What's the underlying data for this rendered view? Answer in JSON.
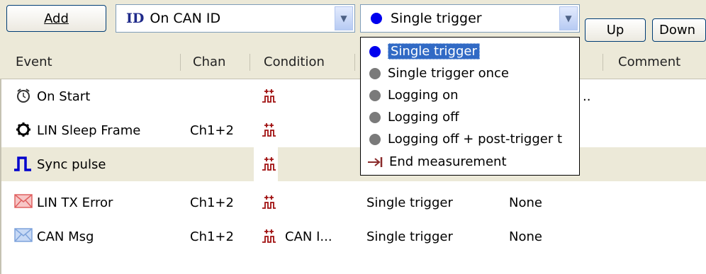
{
  "toolbar": {
    "add_label": "Add",
    "event_type": {
      "logo": "ID",
      "value": "On CAN ID"
    },
    "action_select": {
      "value": "Single trigger"
    },
    "up_label": "Up",
    "down_label": "Down"
  },
  "table": {
    "columns": [
      "Event",
      "Chan",
      "Condition",
      "Comment"
    ],
    "rows": [
      {
        "event": "On Start",
        "chan": "",
        "condition": "",
        "action": "",
        "comment": "",
        "trunc": "..",
        "icon": "alarm-clock-icon"
      },
      {
        "event": "LIN Sleep Frame",
        "chan": "Ch1+2",
        "condition": "",
        "action": "",
        "comment": "",
        "icon": "gear-icon"
      },
      {
        "event": "Sync pulse",
        "chan": "",
        "condition": "",
        "action": "",
        "comment": "",
        "icon": "pulse-icon"
      },
      {
        "event": "LIN TX Error",
        "chan": "Ch1+2",
        "condition": "",
        "action": "Single trigger",
        "comment": "None",
        "icon": "error-envelope-icon"
      },
      {
        "event": "CAN Msg",
        "chan": "Ch1+2",
        "condition": "CAN I...",
        "action": "Single trigger",
        "comment": "None",
        "icon": "envelope-icon"
      }
    ]
  },
  "dropdown": {
    "options": [
      {
        "label": "Single trigger",
        "icon": "blue-dot-icon",
        "highlighted": true
      },
      {
        "label": "Single trigger once",
        "icon": "gray-dot-icon"
      },
      {
        "label": "Logging on",
        "icon": "gray-dot-icon"
      },
      {
        "label": "Logging off",
        "icon": "gray-dot-icon"
      },
      {
        "label": "Logging off + post-trigger t",
        "icon": "gray-dot-icon"
      },
      {
        "label": "End measurement",
        "icon": "arrow-to-bar-icon"
      }
    ]
  },
  "colors": {
    "selection": "#316ac5",
    "toolbar_bg": "#ece9d8",
    "selected_row": "#ece9d8"
  }
}
